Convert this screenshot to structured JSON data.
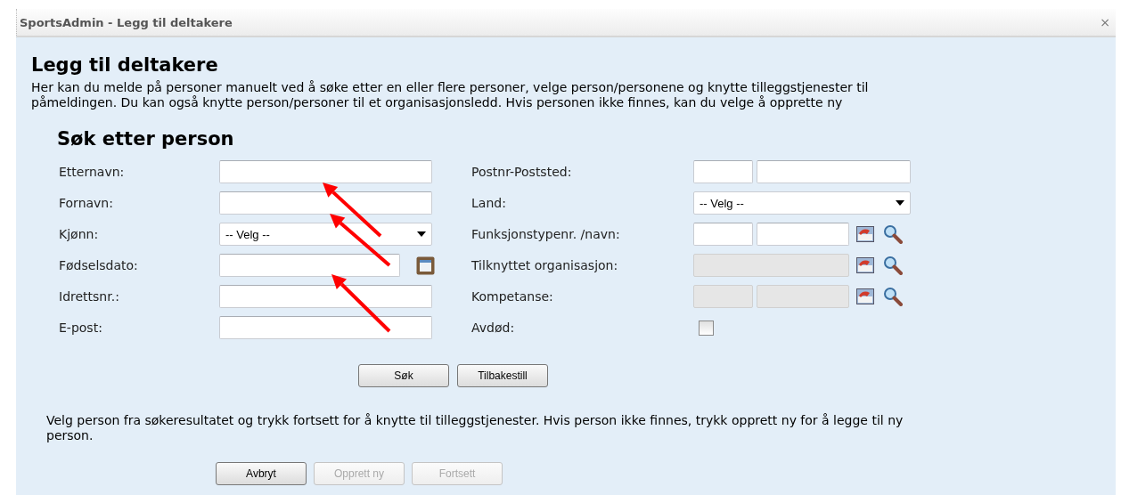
{
  "window": {
    "title": "SportsAdmin - Legg til deltakere",
    "close": "×"
  },
  "heading": "Legg til deltakere",
  "intro": "Her kan du melde på personer manuelt ved å søke etter en eller flere personer, velge person/personene og knytte tilleggstjenester til påmeldingen. Du kan også knytte person/personer til et organisasjonsledd. Hvis personen ikke finnes, kan du velge å opprette ny",
  "search": {
    "heading": "Søk etter person",
    "left_rows": [
      {
        "label": "Etternavn:",
        "lookup": false,
        "controls": [
          {
            "kind": "text",
            "disabled": false
          }
        ]
      },
      {
        "label": "Fornavn:",
        "lookup": false,
        "controls": [
          {
            "kind": "text",
            "disabled": false
          }
        ]
      },
      {
        "label": "Kjønn:",
        "lookup": false,
        "controls": [
          {
            "kind": "select",
            "value": "-- Velg --"
          }
        ]
      },
      {
        "label": "Fødselsdato:",
        "lookup": false,
        "controls": [
          {
            "kind": "date",
            "disabled": false
          }
        ]
      },
      {
        "label": "Idrettsnr.:",
        "lookup": false,
        "controls": [
          {
            "kind": "text",
            "disabled": false
          }
        ]
      },
      {
        "label": "E-post:",
        "lookup": false,
        "controls": [
          {
            "kind": "text",
            "disabled": false
          }
        ]
      }
    ],
    "right_rows": [
      {
        "label": "Postnr-Poststed:",
        "lookup": false,
        "controls": [
          {
            "kind": "text",
            "disabled": false
          },
          {
            "kind": "text",
            "disabled": false
          }
        ]
      },
      {
        "label": "Land:",
        "lookup": false,
        "controls": [
          {
            "kind": "select",
            "value": "-- Velg --"
          }
        ]
      },
      {
        "label": "Funksjonstypenr. /navn:",
        "lookup": true,
        "controls": [
          {
            "kind": "text",
            "disabled": false
          },
          {
            "kind": "text",
            "disabled": false
          }
        ]
      },
      {
        "label": "Tilknyttet organisasjon:",
        "lookup": true,
        "controls": [
          {
            "kind": "text",
            "disabled": true
          }
        ]
      },
      {
        "label": "Kompetanse:",
        "lookup": true,
        "controls": [
          {
            "kind": "text",
            "disabled": true
          },
          {
            "kind": "text",
            "disabled": true
          }
        ]
      },
      {
        "label": "Avdød:",
        "lookup": false,
        "controls": [
          {
            "kind": "checkbox",
            "checked": false
          }
        ]
      }
    ],
    "buttons": [
      {
        "label": "Søk",
        "disabled": false
      },
      {
        "label": "Tilbakestill",
        "disabled": false
      }
    ]
  },
  "instructions": "Velg person fra søkeresultatet og trykk fortsett for å knytte til tilleggstjenester. Hvis person ikke finnes, trykk opprett ny for å legge til ny person.",
  "actions": [
    {
      "label": "Avbryt",
      "disabled": false
    },
    {
      "label": "Opprett ny",
      "disabled": true
    },
    {
      "label": "Fortsett",
      "disabled": true
    }
  ],
  "annotations": [
    {
      "kind": "arrow"
    },
    {
      "kind": "arrow"
    },
    {
      "kind": "arrow"
    }
  ]
}
